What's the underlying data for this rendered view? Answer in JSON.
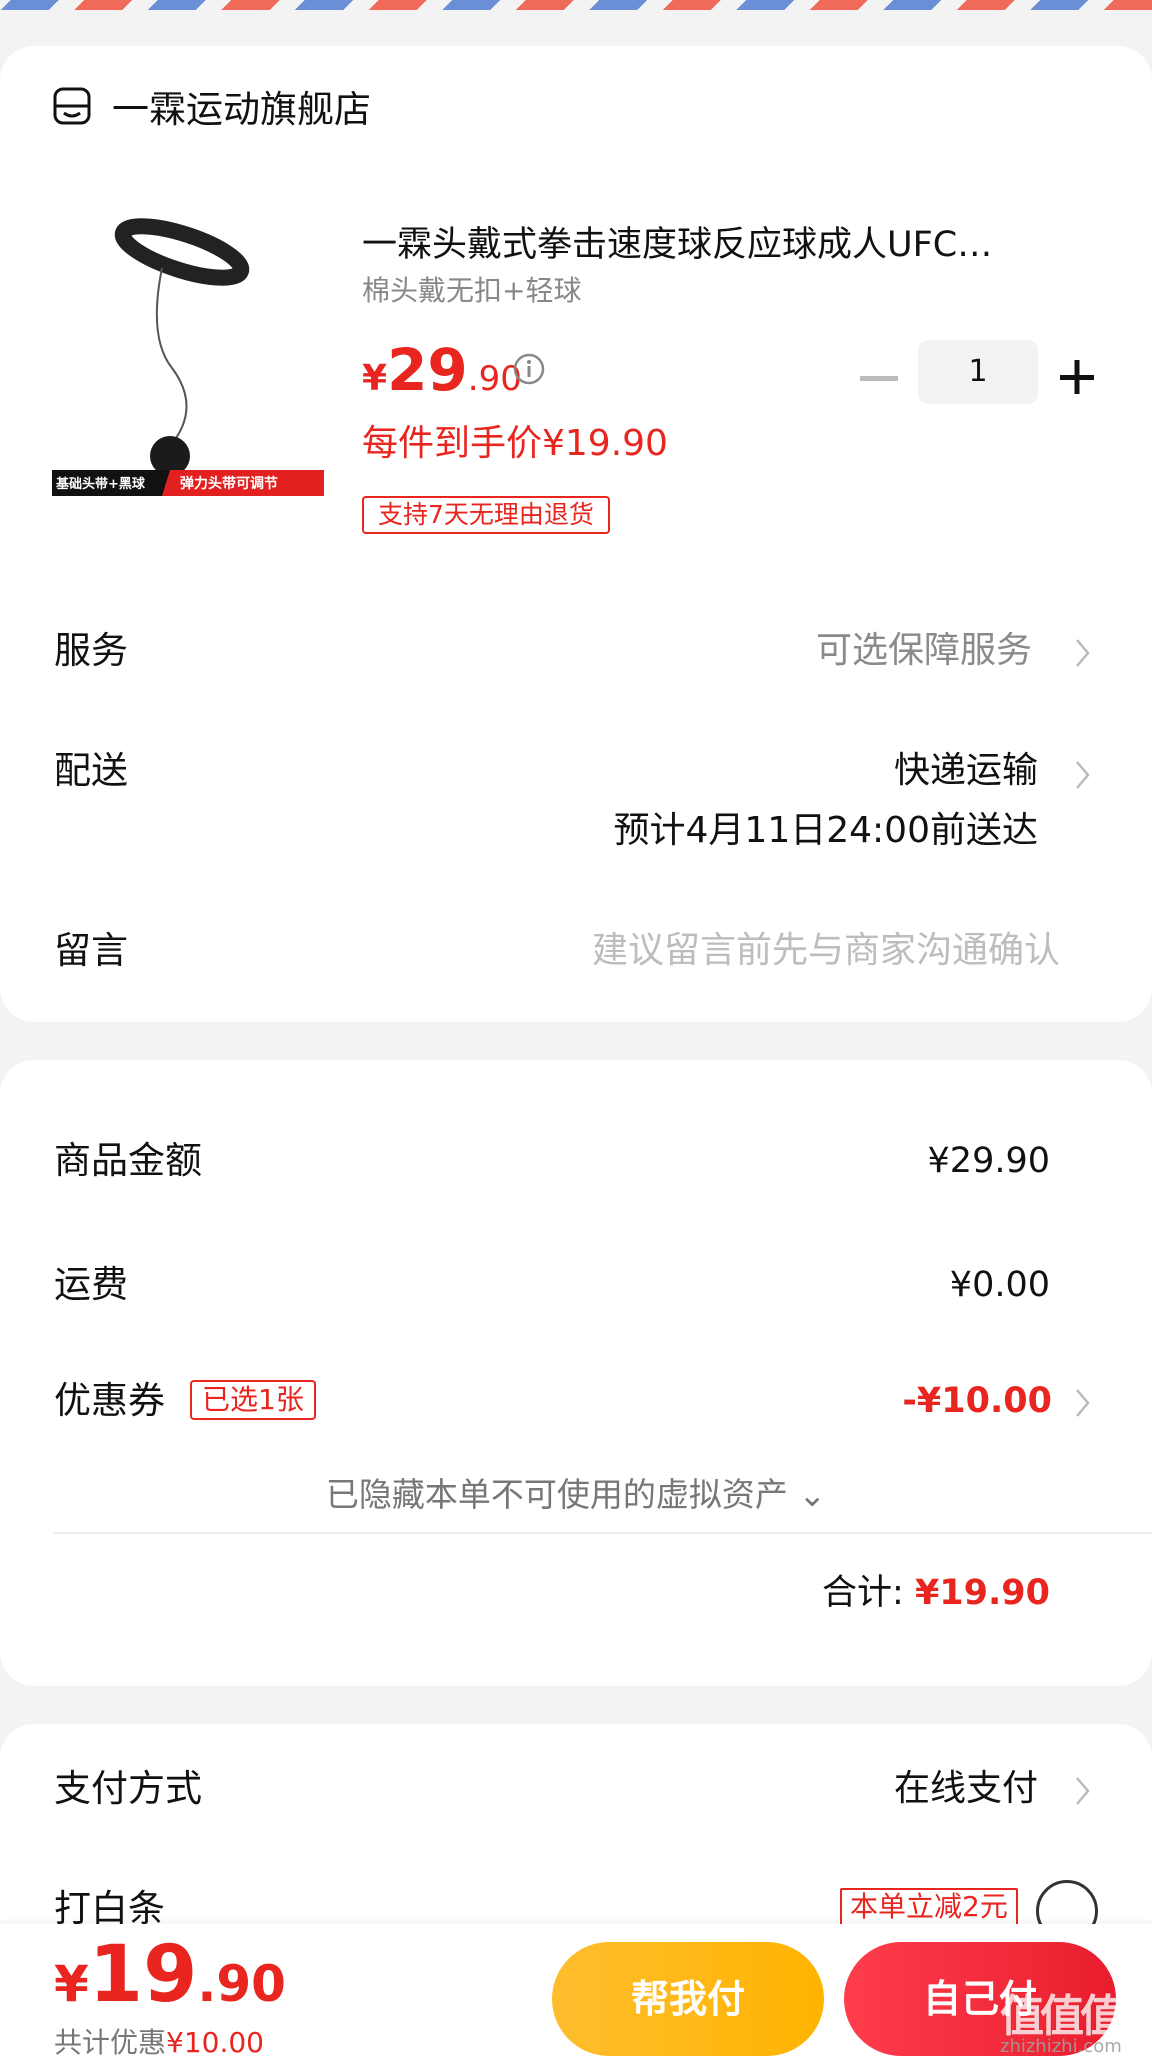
{
  "store": {
    "name": "一霖运动旗舰店",
    "icon": "store-icon"
  },
  "product": {
    "title": "一霖头戴式拳击速度球反应球成人UFC…",
    "spec": "棉头戴无扣+轻球",
    "price_symbol": "¥",
    "price_int": "29",
    "price_dec": ".90",
    "per_price": "每件到手价¥19.90",
    "return_tag": "支持7天无理由退货",
    "quantity": "1",
    "thumb_left_text": "基础头带+黑球",
    "thumb_right_text": "弹力头带可调节"
  },
  "service": {
    "label": "服务",
    "value": "可选保障服务"
  },
  "delivery": {
    "label": "配送",
    "value": "快递运输",
    "eta": "预计4月11日24:00前送达"
  },
  "message": {
    "label": "留言",
    "placeholder": "建议留言前先与商家沟通确认"
  },
  "summary": {
    "goods_label": "商品金额",
    "goods_value": "¥29.90",
    "shipping_label": "运费",
    "shipping_value": "¥0.00",
    "coupon_label": "优惠券",
    "coupon_badge": "已选1张",
    "coupon_value": "-¥10.00",
    "hidden_assets": "已隐藏本单不可使用的虚拟资产 ⌄",
    "total_label": "合计:",
    "total_value": "¥19.90"
  },
  "payment": {
    "method_label": "支付方式",
    "method_value": "在线支付",
    "ious_label": "打白条",
    "ious_tag": "本单立减2元"
  },
  "bottom": {
    "price_symbol": "¥",
    "price_int": "19",
    "price_dec": ".90",
    "savings_label": "共计优惠",
    "savings_value": "¥10.00",
    "help_pay": "帮我付",
    "self_pay": "自己付"
  },
  "watermark": {
    "main": "值值值",
    "sub": "zhizhizhi.com"
  },
  "colors": {
    "accent": "#e8251f",
    "help_btn": "#ffb400",
    "self_btn": "#ef2233"
  }
}
